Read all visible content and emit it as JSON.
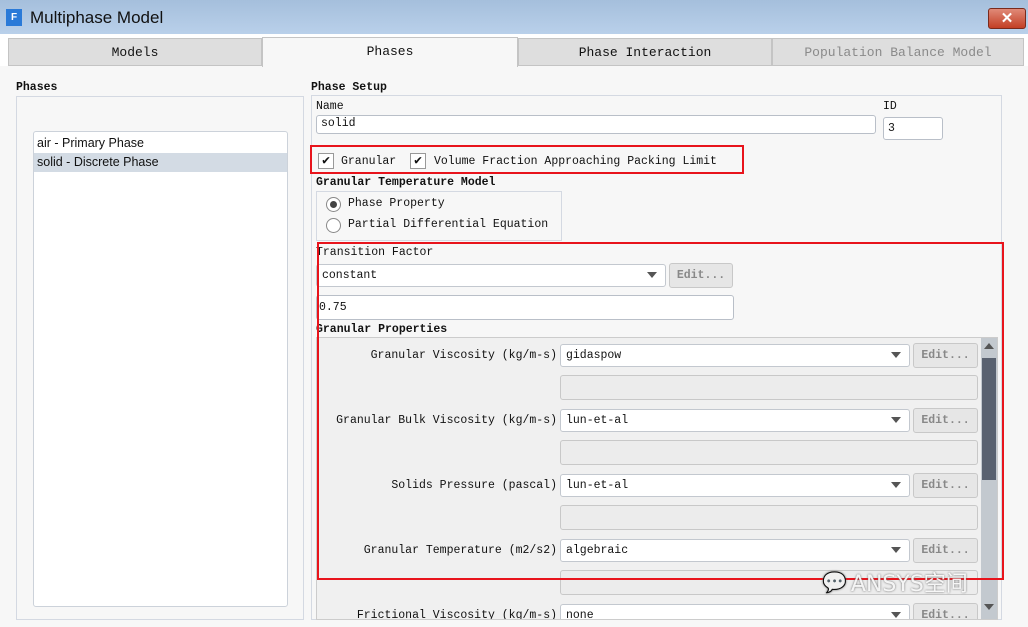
{
  "window": {
    "title": "Multiphase Model",
    "icon_letter": "F"
  },
  "tabs": [
    {
      "label": "Models"
    },
    {
      "label": "Phases",
      "active": true
    },
    {
      "label": "Phase Interaction"
    },
    {
      "label": "Population Balance Model",
      "disabled": true
    }
  ],
  "phases": {
    "title": "Phases",
    "items": [
      {
        "label": "air - Primary Phase"
      },
      {
        "label": "solid - Discrete Phase",
        "selected": true
      }
    ]
  },
  "setup": {
    "title": "Phase Setup",
    "name_label": "Name",
    "name_value": "solid",
    "id_label": "ID",
    "id_value": "3",
    "granular_label": "Granular",
    "granular_checked": true,
    "packing_label": "Volume Fraction Approaching Packing Limit",
    "packing_checked": true,
    "temp_model_title": "Granular Temperature Model",
    "temp_model_options": [
      {
        "label": "Phase Property",
        "selected": true
      },
      {
        "label": "Partial Differential Equation",
        "selected": false
      }
    ],
    "transition_label": "Transition Factor",
    "transition_method": "constant",
    "transition_value": "0.75",
    "edit_label": "Edit...",
    "granular_props_title": "Granular Properties",
    "properties": [
      {
        "label": "Granular Viscosity (kg/m-s)",
        "value": "gidaspow"
      },
      {
        "label": "Granular Bulk Viscosity (kg/m-s)",
        "value": "lun-et-al"
      },
      {
        "label": "Solids Pressure (pascal)",
        "value": "lun-et-al"
      },
      {
        "label": "Granular Temperature (m2/s2)",
        "value": "algebraic"
      },
      {
        "label": "Frictional Viscosity (kg/m-s)",
        "value": "none"
      }
    ]
  },
  "watermark": "ANSYS空间",
  "colors": {
    "highlight": "#e8141c",
    "selected_row": "#d3dbe4",
    "titlebar": "#a5bfdc"
  }
}
